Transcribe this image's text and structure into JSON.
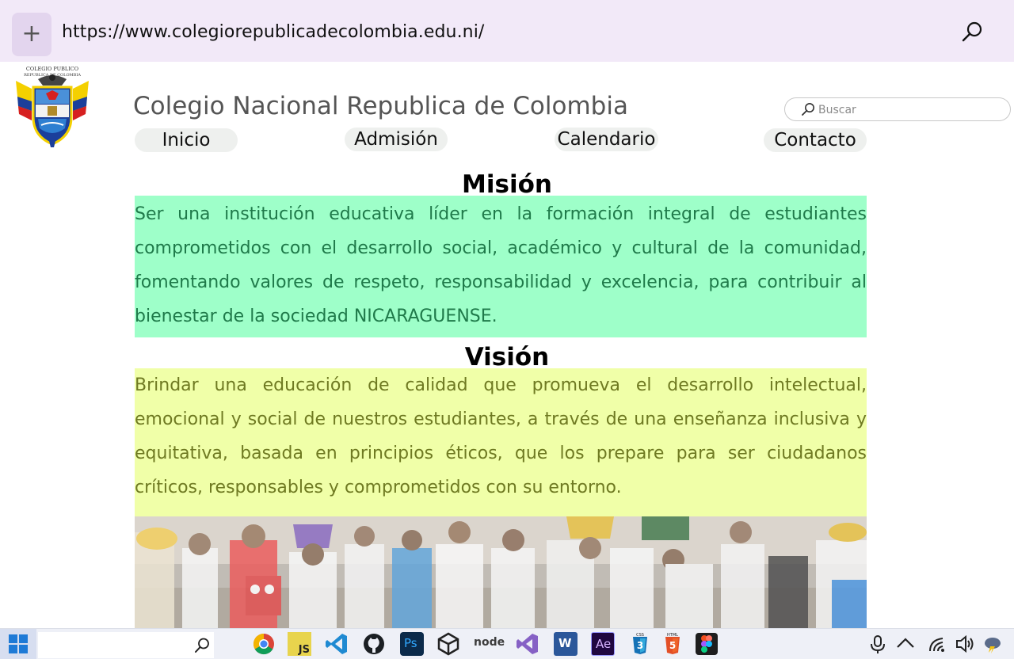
{
  "browser": {
    "url": "https://www.colegiorepublicadecolombia.edu.ni/",
    "new_tab_label": "+"
  },
  "header": {
    "logo_text_top": "COLEGIO PUBLICO",
    "logo_text_bottom": "REPUBLICA DE COLOMBIA",
    "title": "Colegio Nacional Republica de Colombia",
    "search_placeholder": "Buscar"
  },
  "nav": {
    "items": [
      {
        "label": "Inicio"
      },
      {
        "label": "Admisión"
      },
      {
        "label": "Calendario"
      },
      {
        "label": "Contacto"
      }
    ]
  },
  "mision": {
    "title": "Misión",
    "text": "Ser una institución educativa líder en la formación integral de estudiantes comprometidos con el desarrollo social, académico y cultural de la comunidad, fomentando valores de respeto, responsabilidad y excelencia, para contribuir al bienestar de la sociedad NICARAGUENSE.",
    "bg_color": "#9effc9",
    "text_color": "#1f7a4a"
  },
  "vision": {
    "title": "Visión",
    "text": "Brindar una educación de calidad que promueva el desarrollo intelectual, emocional y social de nuestros estudiantes, a través de una enseñanza inclusiva y equitativa, basada en principios éticos, que los prepare para ser ciudadanos críticos, responsables y comprometidos con su entorno.",
    "bg_color": "#f0ffa8",
    "text_color": "#6f7a22"
  },
  "taskbar": {
    "apps": [
      "windows-start-icon",
      "search-icon",
      "chrome-icon",
      "javascript-icon",
      "vscode-icon",
      "github-icon",
      "photoshop-icon",
      "unity-icon",
      "nodejs-icon",
      "visual-studio-icon",
      "word-icon",
      "after-effects-icon",
      "css3-icon",
      "html5-icon",
      "figma-icon"
    ],
    "tray": [
      "microphone-icon",
      "chevron-up-icon",
      "wifi-icon",
      "volume-icon",
      "weather-icon"
    ],
    "js_label": "JS",
    "ps_label": "Ps",
    "ae_label": "Ae",
    "word_label": "W",
    "node_label": "node",
    "css_label": "CSS",
    "html_label": "HTML"
  }
}
